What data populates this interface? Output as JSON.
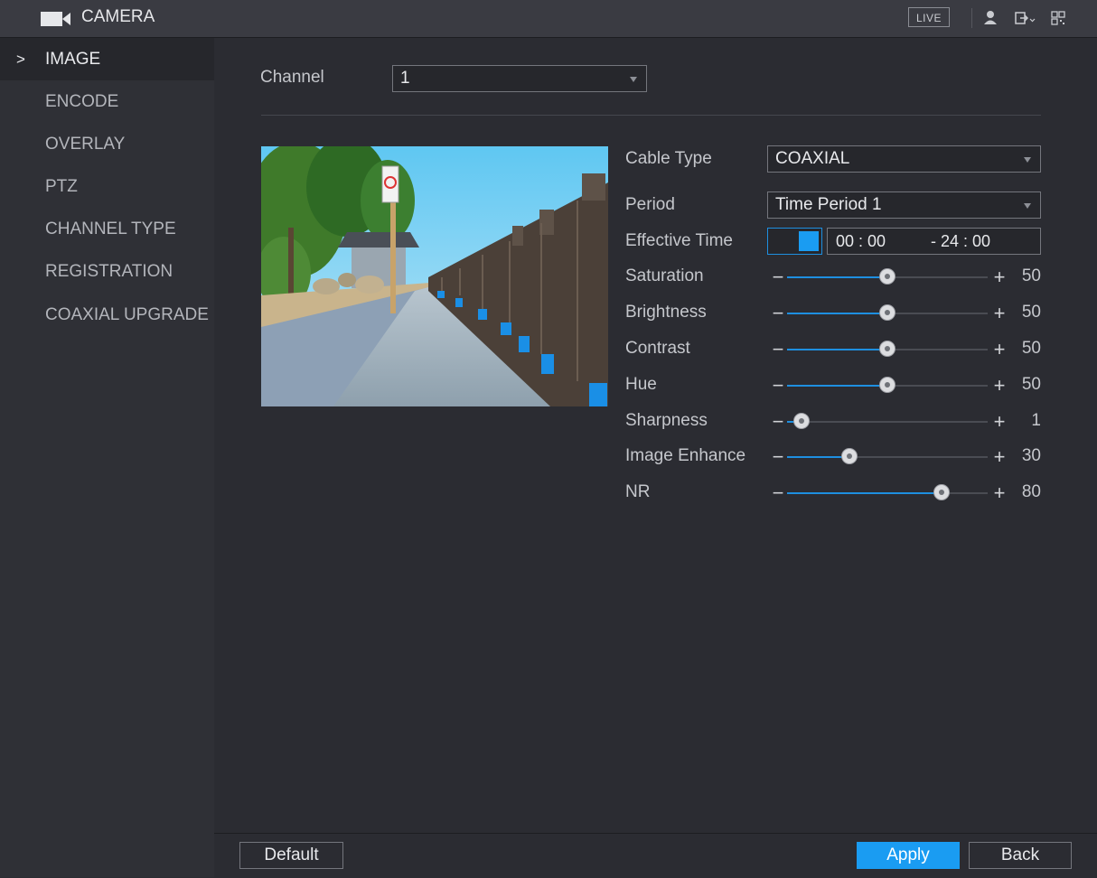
{
  "header": {
    "title": "CAMERA",
    "live_label": "LIVE",
    "icons": [
      "camera-icon",
      "user-icon",
      "logout-icon",
      "qr-code-icon"
    ]
  },
  "sidebar": {
    "items": [
      {
        "label": "IMAGE",
        "active": true
      },
      {
        "label": "ENCODE"
      },
      {
        "label": "OVERLAY"
      },
      {
        "label": "PTZ"
      },
      {
        "label": "CHANNEL TYPE"
      },
      {
        "label": "REGISTRATION"
      },
      {
        "label": "COAXIAL UPGRADE"
      }
    ],
    "active_marker": ">"
  },
  "main": {
    "channel_label": "Channel",
    "channel_value": "1",
    "cable_type_label": "Cable Type",
    "cable_type_value": "COAXIAL",
    "period_label": "Period",
    "period_value": "Time Period 1",
    "effective_time_label": "Effective Time",
    "effective_time_enabled": true,
    "time_start": "00 : 00",
    "time_end": "- 24 : 00",
    "sliders": [
      {
        "label": "Saturation",
        "value": "50",
        "percent": 50
      },
      {
        "label": "Brightness",
        "value": "50",
        "percent": 50
      },
      {
        "label": "Contrast",
        "value": "50",
        "percent": 50
      },
      {
        "label": "Hue",
        "value": "50",
        "percent": 50
      },
      {
        "label": "Sharpness",
        "value": "1",
        "percent": 7
      },
      {
        "label": "Image Enhance",
        "value": "30",
        "percent": 31
      },
      {
        "label": "NR",
        "value": "80",
        "percent": 77
      }
    ],
    "minus_symbol": "−",
    "plus_symbol": "+"
  },
  "footer": {
    "default_label": "Default",
    "apply_label": "Apply",
    "back_label": "Back"
  },
  "colors": {
    "accent": "#1a9cf2",
    "background": "#2b2c32",
    "topbar": "#3a3b42"
  }
}
